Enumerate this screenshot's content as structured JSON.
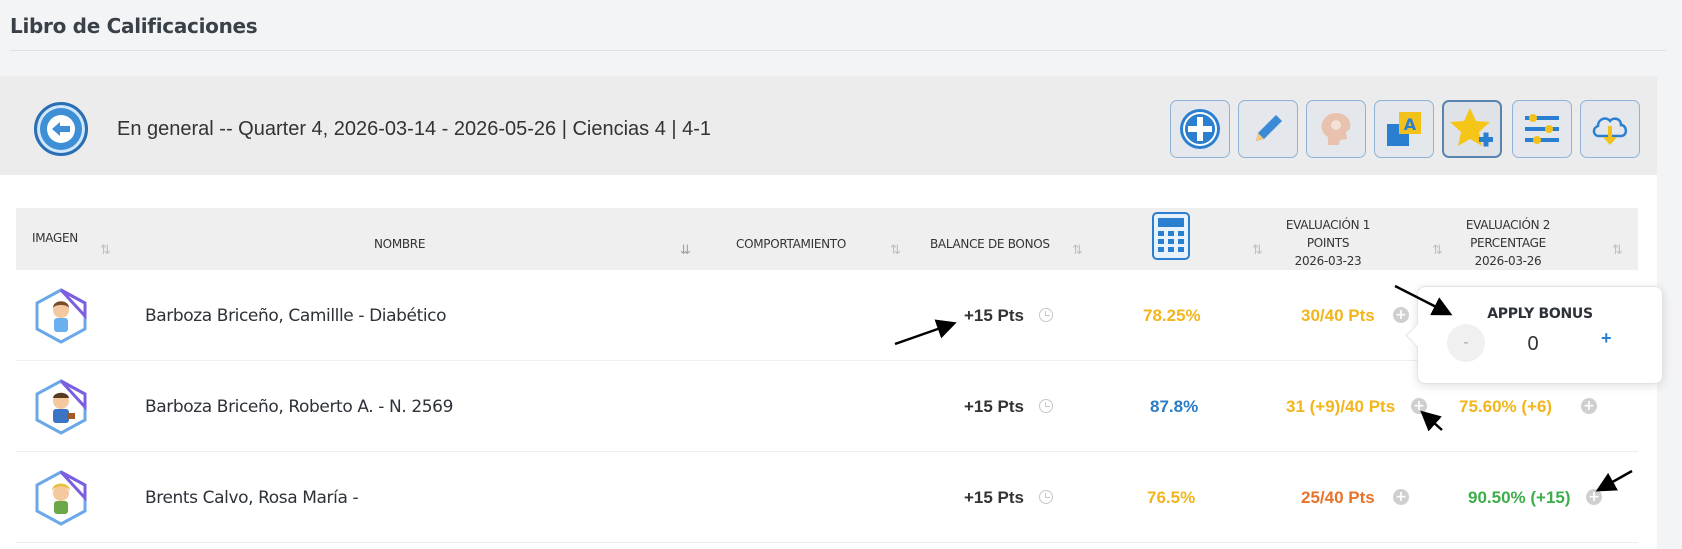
{
  "page": {
    "title": "Libro de Calificaciones"
  },
  "header": {
    "breadcrumb": "En general -- Quarter 4, 2026-03-14 - 2026-05-26 | Ciencias 4 | 4-1",
    "tools": [
      "add-icon",
      "pencil-icon",
      "brain-icon",
      "add-letter-icon",
      "star-plus-icon",
      "sliders-icon",
      "cloud-download-icon"
    ]
  },
  "table": {
    "columns": {
      "imagen": "IMAGEN",
      "nombre": "NOMBRE",
      "comportamiento": "COMPORTAMIENTO",
      "balance": "BALANCE DE BONOS",
      "eval1": {
        "title": "EVALUACIÓN 1",
        "type": "POINTS",
        "date": "2026-03-23"
      },
      "eval2": {
        "title": "EVALUACIÓN 2",
        "type": "PERCENTAGE",
        "date": "2026-03-26"
      }
    },
    "rows": [
      {
        "name": "Barboza Briceño, Camillle - Diabético",
        "bonus": "+15 Pts",
        "overall": "78.25%",
        "overall_color": "#f2b51c",
        "eval1": "30/40 Pts",
        "eval1_color": "#f2b51c",
        "eval2": "",
        "eval2_color": "#f2b51c"
      },
      {
        "name": "Barboza Briceño, Roberto A. - N. 2569",
        "bonus": "+15 Pts",
        "overall": "87.8%",
        "overall_color": "#2c7cc4",
        "eval1": "31 (+9)/40 Pts",
        "eval1_color": "#f2b51c",
        "eval2": "75.60% (+6)",
        "eval2_color": "#f2b51c"
      },
      {
        "name": "Brents Calvo, Rosa María -",
        "bonus": "+15 Pts",
        "overall": "76.5%",
        "overall_color": "#f2b51c",
        "eval1": "25/40 Pts",
        "eval1_color": "#e8742a",
        "eval2": "90.50% (+15)",
        "eval2_color": "#3dae4a"
      }
    ]
  },
  "popover": {
    "title": "APPLY BONUS",
    "minus": "-",
    "value": "0",
    "plus": "+"
  }
}
